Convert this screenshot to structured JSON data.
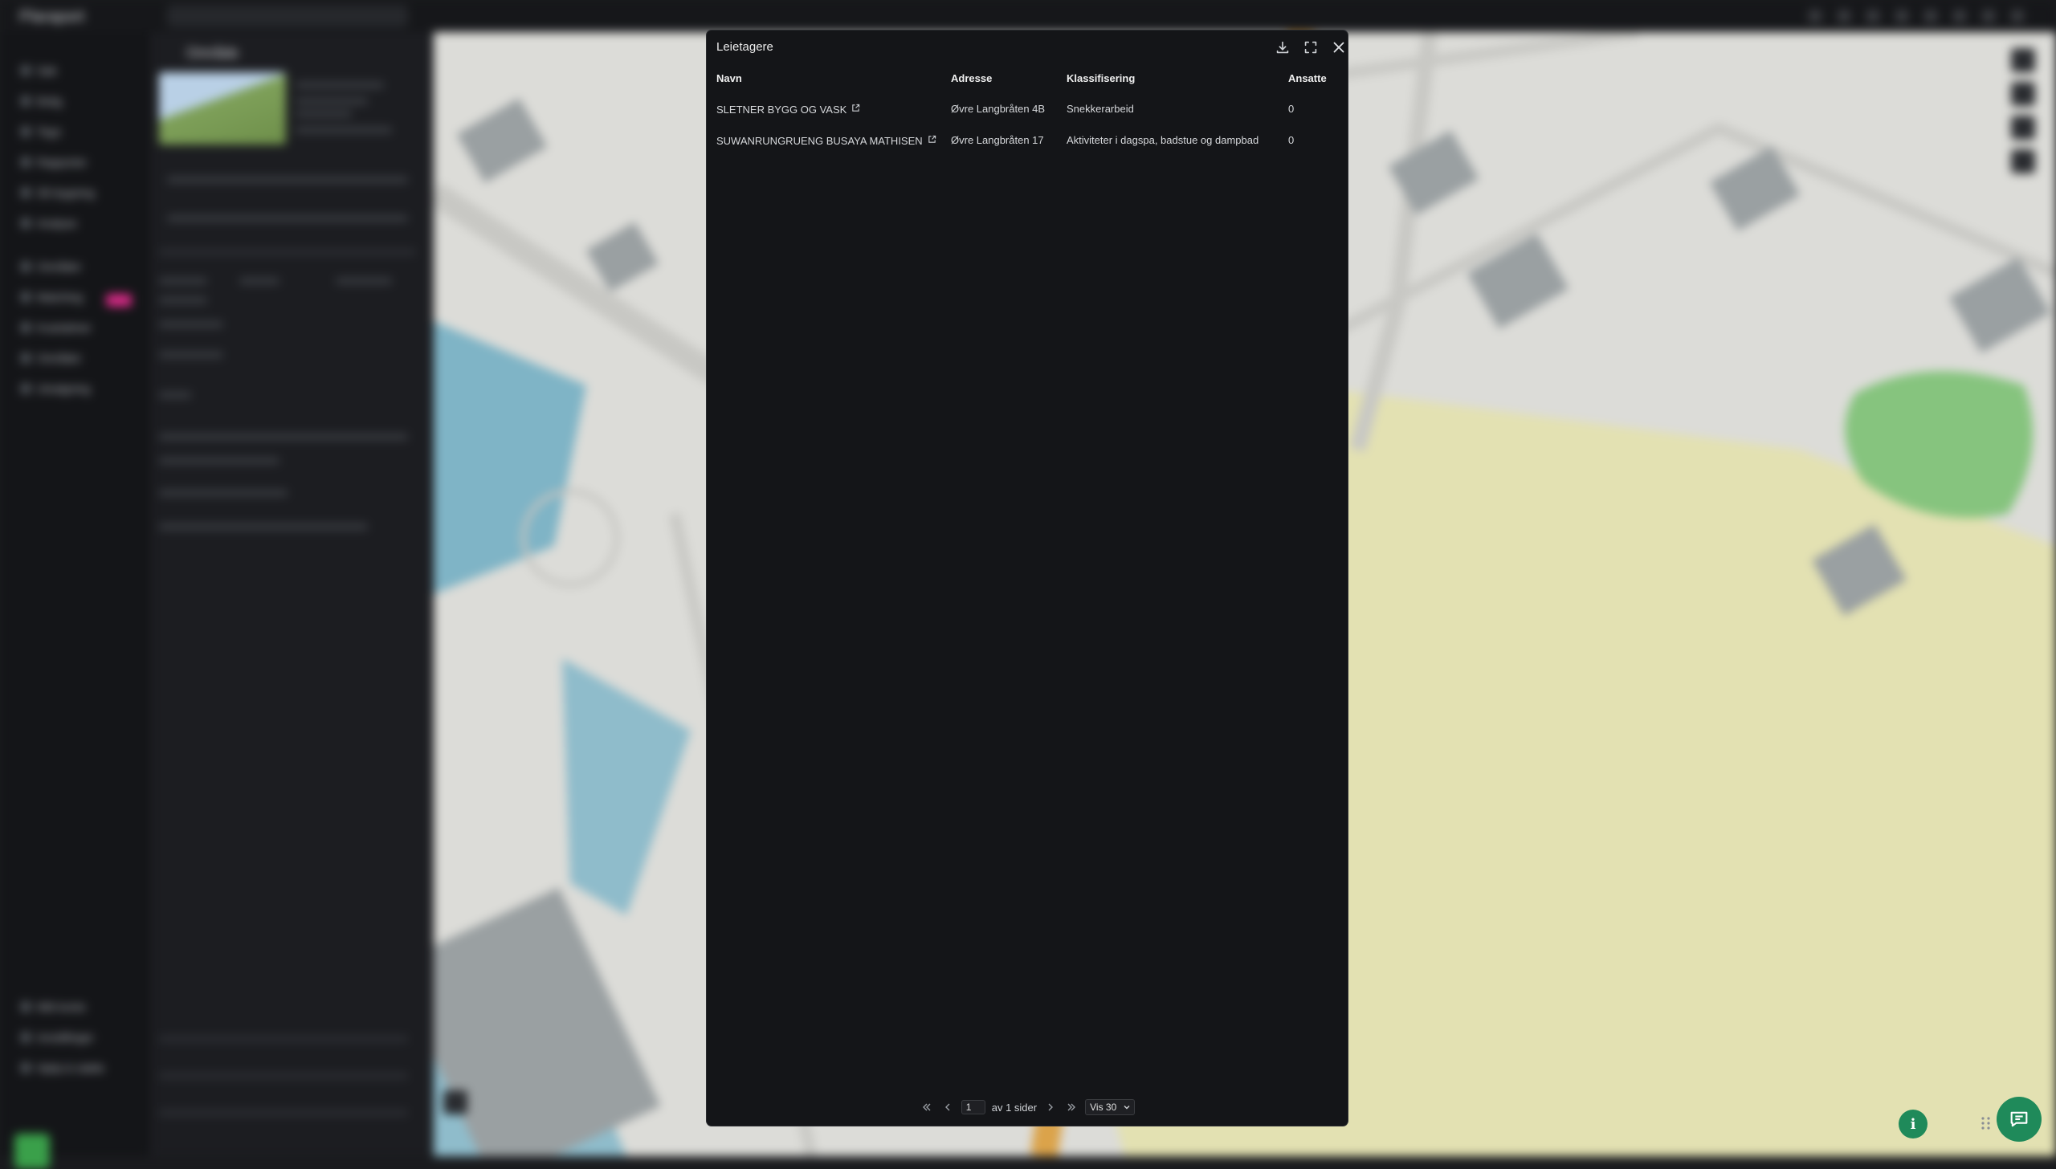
{
  "background": {
    "brand": "Plaraport",
    "nav_items": [
      "Søk",
      "Bolig",
      "Tegn",
      "Rapporter",
      "3D-bygning",
      "Analyse",
      "Områder",
      "Matching",
      "Kvartalmer",
      "Områder",
      "Utvalgning",
      "Mitt konto",
      "Innstillinger",
      "Hjelp & støtte"
    ],
    "panel_title": "Område",
    "panel_tabs": [
      "Grunnfakta",
      "Tomt",
      "Bygg",
      "Eiere",
      "Leietagere"
    ]
  },
  "modal": {
    "title": "Leietagere",
    "icons": {
      "download": "download-icon",
      "expand": "expand-icon",
      "close": "close-icon"
    },
    "columns": [
      "Navn",
      "Adresse",
      "Klassifisering",
      "Ansatte"
    ],
    "rows": [
      {
        "name": "SLETNER BYGG OG VASK",
        "address": "Øvre Langbråten 4B",
        "classification": "Snekkerarbeid",
        "employees": "0"
      },
      {
        "name": "SUWANRUNGRUENG BUSAYA MATHISEN",
        "address": "Øvre Langbråten 17",
        "classification": "Aktiviteter i dagspa, badstue og dampbad",
        "employees": "0"
      }
    ],
    "pagination": {
      "current_page": "1",
      "of_label": "av 1 sider",
      "page_size_label": "Vis 30"
    }
  },
  "colors": {
    "accent": "#1f8a5a",
    "modal_bg": "#141518",
    "map_road": "#e0a040",
    "map_field": "#e8e6b4",
    "map_green": "#7fc77a",
    "map_water": "#6fb0c8"
  }
}
